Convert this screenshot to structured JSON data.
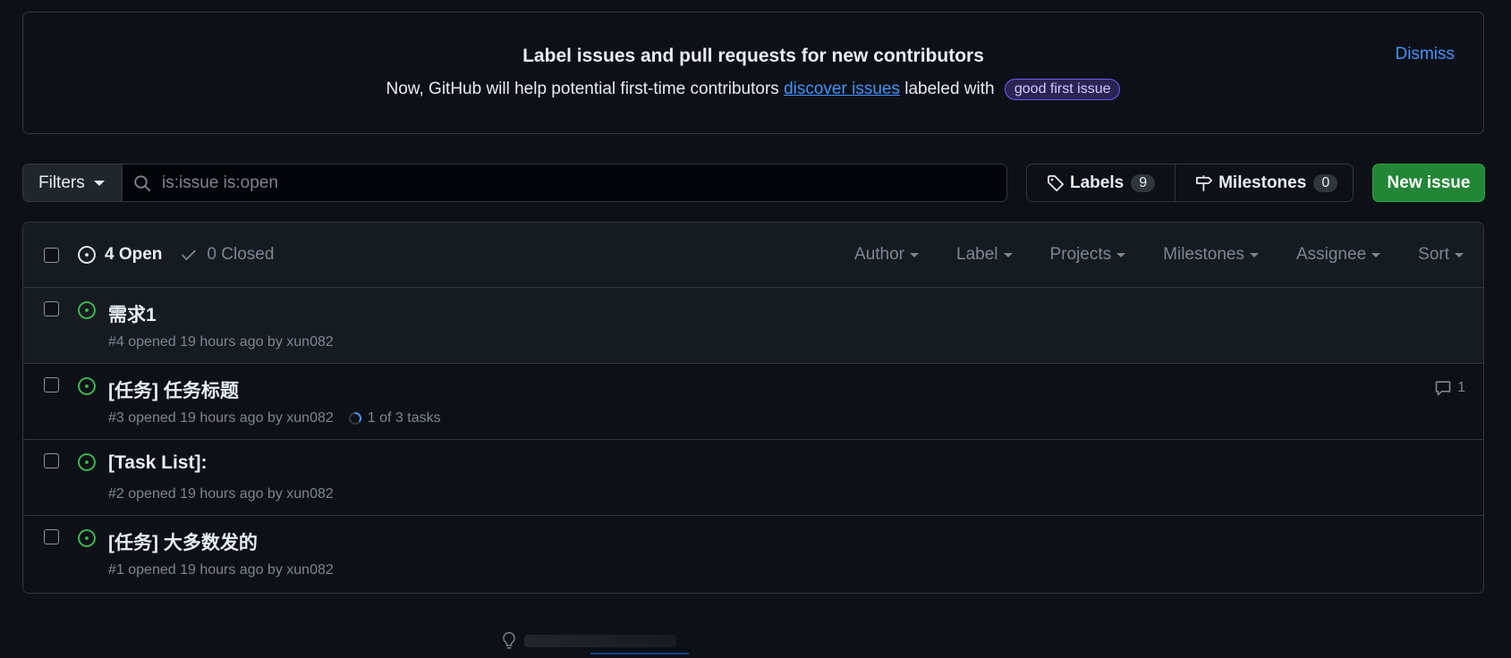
{
  "banner": {
    "title": "Label issues and pull requests for new contributors",
    "text_before": "Now, GitHub will help potential first-time contributors ",
    "link": "discover issues",
    "text_after": " labeled with",
    "label": "good first issue",
    "dismiss": "Dismiss"
  },
  "toolbar": {
    "filters_label": "Filters",
    "search_value": "is:issue is:open",
    "labels_label": "Labels",
    "labels_count": "9",
    "milestones_label": "Milestones",
    "milestones_count": "0",
    "new_issue_label": "New issue"
  },
  "list_header": {
    "open_label": "4 Open",
    "closed_label": "0 Closed",
    "filters": [
      "Author",
      "Label",
      "Projects",
      "Milestones",
      "Assignee",
      "Sort"
    ]
  },
  "issues": [
    {
      "title": "需求1",
      "meta": "#4 opened 19 hours ago by xun082"
    },
    {
      "title": "[任务] 任务标题",
      "meta": "#3 opened 19 hours ago by xun082",
      "tasks": "1 of 3 tasks",
      "comments": "1"
    },
    {
      "title": "[Task List]:",
      "meta": "#2 opened 19 hours ago by xun082"
    },
    {
      "title": "[任务] 大多数发的",
      "meta": "#1 opened 19 hours ago by xun082"
    }
  ],
  "colors": {
    "background": "#0d1117",
    "accent_link": "#4493f8",
    "open_green": "#3fb950",
    "new_issue_green": "#238636"
  }
}
